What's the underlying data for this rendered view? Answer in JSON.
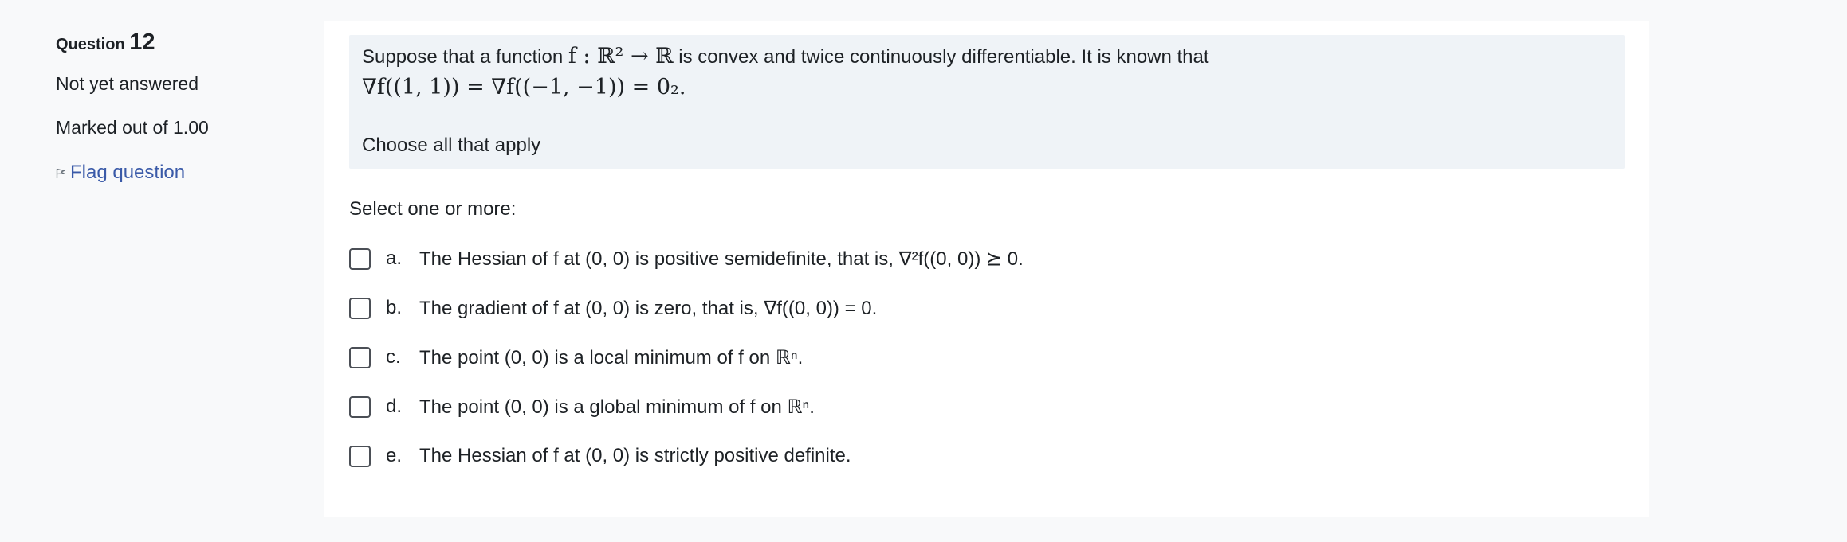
{
  "info": {
    "question_label": "Question",
    "question_number": "12",
    "status": "Not yet answered",
    "marks": "Marked out of 1.00",
    "flag_label": "Flag question"
  },
  "question": {
    "text_line1_before": "Suppose that a function",
    "text_line1_math": "f : ℝ² → ℝ",
    "text_line1_after": "is convex and twice continuously differentiable. It is known that",
    "text_line2_math": "∇f((1, 1)) = ∇f((−1, −1)) = 0₂.",
    "choose": "Choose all that apply"
  },
  "prompt": "Select one or more:",
  "options": [
    {
      "letter": "a.",
      "text": "The Hessian of f at (0, 0) is positive semidefinite, that is, ∇²f((0, 0)) ⪰ 0.",
      "checked": false
    },
    {
      "letter": "b.",
      "text": "The gradient of f at (0, 0) is zero, that is, ∇f((0, 0)) = 0.",
      "checked": false
    },
    {
      "letter": "c.",
      "text": "The point (0, 0) is a local minimum of f on ℝⁿ.",
      "checked": false
    },
    {
      "letter": "d.",
      "text": "The point (0, 0) is a global minimum of f on ℝⁿ.",
      "checked": false
    },
    {
      "letter": "e.",
      "text": "The Hessian of f at (0, 0) is strictly positive definite.",
      "checked": false
    }
  ],
  "colors": {
    "link": "#3a5aa8",
    "formulation_bg": "#eff3f7",
    "page_bg": "#f8f9fa"
  }
}
